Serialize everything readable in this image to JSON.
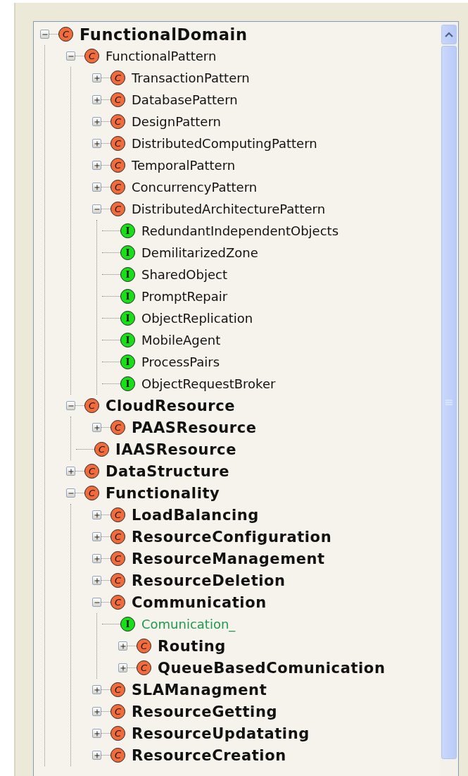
{
  "tree": [
    {
      "label": "FunctionalDomain",
      "badge": "C",
      "kind": "class",
      "bold": true,
      "expanded": true,
      "children": [
        {
          "label": "FunctionalPattern",
          "badge": "C",
          "kind": "class",
          "bold": false,
          "expanded": true,
          "children": [
            {
              "label": "TransactionPattern",
              "badge": "C",
              "kind": "class",
              "bold": false,
              "expanded": false
            },
            {
              "label": "DatabasePattern",
              "badge": "C",
              "kind": "class",
              "bold": false,
              "expanded": false
            },
            {
              "label": "DesignPattern",
              "badge": "C",
              "kind": "class",
              "bold": false,
              "expanded": false
            },
            {
              "label": "DistributedComputingPattern",
              "badge": "C",
              "kind": "class",
              "bold": false,
              "expanded": false
            },
            {
              "label": "TemporalPattern",
              "badge": "C",
              "kind": "class",
              "bold": false,
              "expanded": false
            },
            {
              "label": "ConcurrencyPattern",
              "badge": "C",
              "kind": "class",
              "bold": false,
              "expanded": false
            },
            {
              "label": "DistributedArchitecturePattern",
              "badge": "C",
              "kind": "class",
              "bold": false,
              "expanded": true,
              "children": [
                {
                  "label": "RedundantIndependentObjects",
                  "badge": "I",
                  "kind": "instance",
                  "bold": false
                },
                {
                  "label": "DemilitarizedZone",
                  "badge": "I",
                  "kind": "instance",
                  "bold": false
                },
                {
                  "label": "SharedObject",
                  "badge": "I",
                  "kind": "instance",
                  "bold": false
                },
                {
                  "label": "PromptRepair",
                  "badge": "I",
                  "kind": "instance",
                  "bold": false
                },
                {
                  "label": "ObjectReplication",
                  "badge": "I",
                  "kind": "instance",
                  "bold": false
                },
                {
                  "label": "MobileAgent",
                  "badge": "I",
                  "kind": "instance",
                  "bold": false
                },
                {
                  "label": "ProcessPairs",
                  "badge": "I",
                  "kind": "instance",
                  "bold": false
                },
                {
                  "label": "ObjectRequestBroker",
                  "badge": "I",
                  "kind": "instance",
                  "bold": false
                }
              ]
            }
          ]
        },
        {
          "label": "CloudResource",
          "badge": "C",
          "kind": "class",
          "bold": true,
          "expanded": true,
          "children": [
            {
              "label": "PAASResource",
              "badge": "C",
              "kind": "class",
              "bold": true,
              "expanded": false
            },
            {
              "label": "IAASResource",
              "badge": "C",
              "kind": "class",
              "bold": true
            }
          ]
        },
        {
          "label": "DataStructure",
          "badge": "C",
          "kind": "class",
          "bold": true,
          "expanded": false
        },
        {
          "label": "Functionality",
          "badge": "C",
          "kind": "class",
          "bold": true,
          "expanded": true,
          "children": [
            {
              "label": "LoadBalancing",
              "badge": "C",
              "kind": "class",
              "bold": true,
              "expanded": false
            },
            {
              "label": "ResourceConfiguration",
              "badge": "C",
              "kind": "class",
              "bold": true,
              "expanded": false
            },
            {
              "label": "ResourceManagement",
              "badge": "C",
              "kind": "class",
              "bold": true,
              "expanded": false
            },
            {
              "label": "ResourceDeletion",
              "badge": "C",
              "kind": "class",
              "bold": true,
              "expanded": false
            },
            {
              "label": "Communication",
              "badge": "C",
              "kind": "class",
              "bold": true,
              "expanded": true,
              "children": [
                {
                  "label": "Comunication_",
                  "badge": "I",
                  "kind": "instance",
                  "bold": false,
                  "color": "#1f9a4c"
                },
                {
                  "label": "Routing",
                  "badge": "C",
                  "kind": "class",
                  "bold": true,
                  "expanded": false
                },
                {
                  "label": "QueueBasedComunication",
                  "badge": "C",
                  "kind": "class",
                  "bold": true,
                  "expanded": false
                }
              ]
            },
            {
              "label": "SLAManagment",
              "badge": "C",
              "kind": "class",
              "bold": true,
              "expanded": false
            },
            {
              "label": "ResourceGetting",
              "badge": "C",
              "kind": "class",
              "bold": true,
              "expanded": false
            },
            {
              "label": "ResourceUpdatating",
              "badge": "C",
              "kind": "class",
              "bold": true,
              "expanded": false
            },
            {
              "label": "ResourceCreation",
              "badge": "C",
              "kind": "class",
              "bold": true,
              "expanded": false
            }
          ]
        }
      ]
    }
  ]
}
